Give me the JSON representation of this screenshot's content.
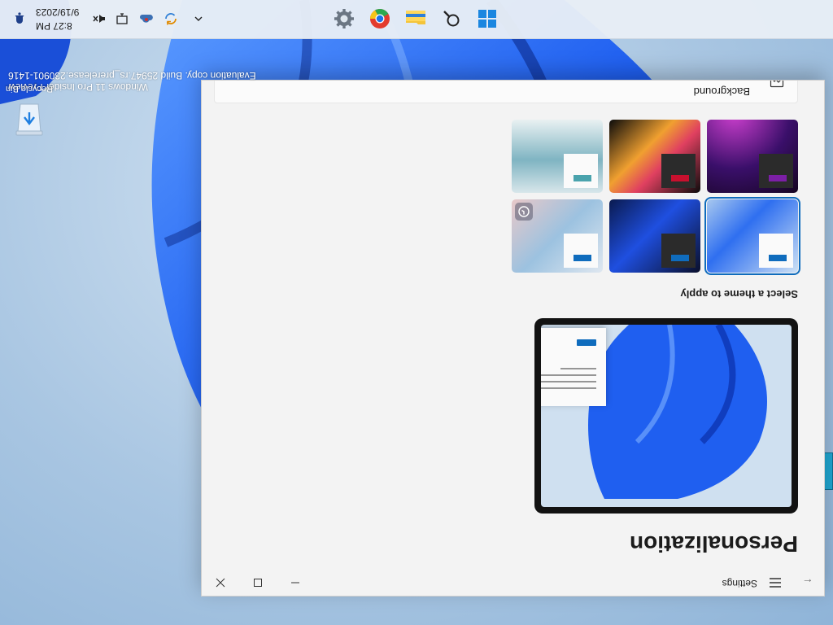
{
  "desktop": {
    "recycle_bin_label": "Recycle Bin",
    "watermark": {
      "line1": "Windows 11 Pro Insider Preview",
      "line2": "Evaluation copy. Build 25947.rs_prerelease.230901-1416"
    }
  },
  "taskbar": {
    "pinned": [
      {
        "icon": "windows-start-icon"
      },
      {
        "icon": "search-icon"
      },
      {
        "icon": "file-explorer-icon"
      },
      {
        "icon": "chrome-icon"
      },
      {
        "icon": "settings-gear-icon"
      }
    ],
    "tray": {
      "icons": [
        "chevron-up-icon",
        "sync-icon",
        "onedrive-icon",
        "network-icon",
        "volume-muted-icon",
        "notification-icon"
      ],
      "time": "8:27 PM",
      "date": "9/19/2023"
    }
  },
  "settings": {
    "app_title": "Settings",
    "page_title": "Personalization",
    "themes_label": "Select a theme to apply",
    "themes": [
      {
        "name": "windows-light-bloom",
        "accent": "#0f6cbd",
        "selected": true
      },
      {
        "name": "windows-dark-bloom",
        "accent": "#0f6cbd",
        "selected": false
      },
      {
        "name": "spotlight-collection",
        "accent": "#0f6cbd",
        "selected": false
      },
      {
        "name": "glow",
        "accent": "#7c1fa6",
        "selected": false
      },
      {
        "name": "captured-motion",
        "accent": "#c8102e",
        "selected": false
      },
      {
        "name": "flow",
        "accent": "#4aa3ad",
        "selected": false
      }
    ],
    "background_row_label": "Background"
  },
  "colors": {
    "accent": "#0f6cbd",
    "window_bg": "#f3f3f3"
  }
}
